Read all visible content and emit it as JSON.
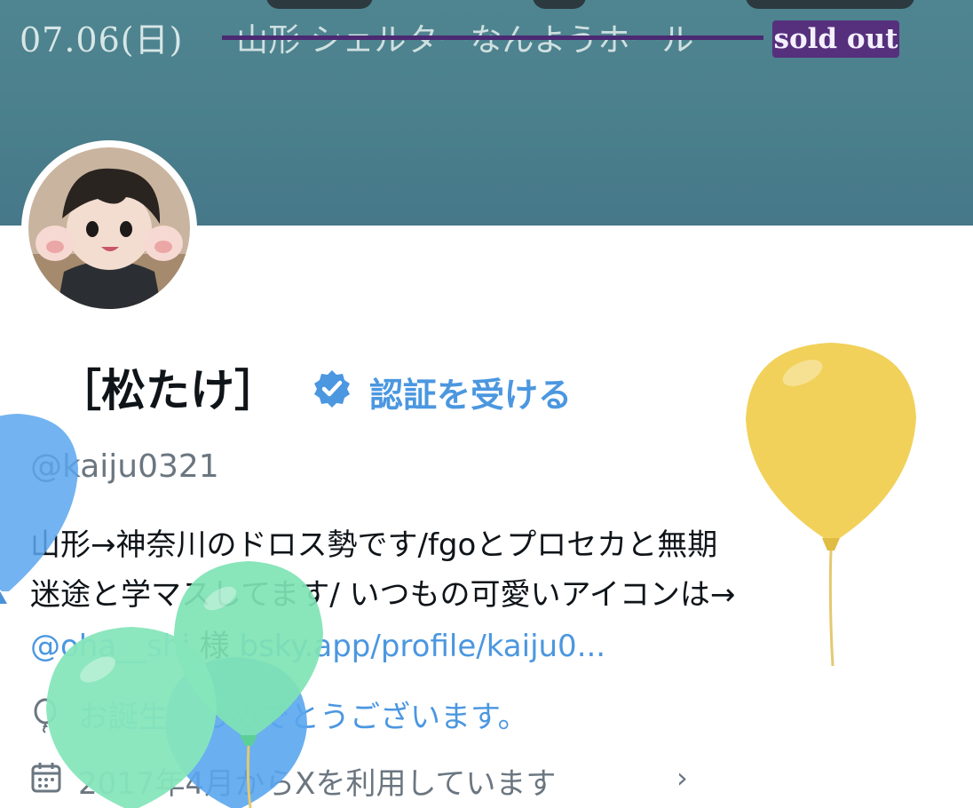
{
  "banner": {
    "date_text": "07.06(日)",
    "venue_text": "山形 シェルターなんようホール",
    "badge": "sold out",
    "strike_color": "#4b2a73",
    "badge_color": "#56307d"
  },
  "profile": {
    "display_name": "［松たけ］",
    "verify_label": "認証を受ける",
    "verified_icon": "verified-badge-icon",
    "handle": "@kaiju0321"
  },
  "bio": {
    "line1": "山形→神奈川のドロス勢です/fgoとプロセカと無期",
    "line2": "迷途と学マスしてます/ いつもの可愛いアイコンは→",
    "mention": "@oha__shi",
    "honorific": "様",
    "url": "bsky.app/profile/kaiju0..."
  },
  "meta": {
    "birthday_icon": "balloon-icon",
    "birthday_text": "お誕生日おめでとうございます。",
    "joined_icon": "calendar-icon",
    "joined_text": "2017年4月からXを利用しています",
    "chevron": "›"
  },
  "colors": {
    "accent": "#4b97e0",
    "muted_text": "#6b7680",
    "banner": "#4a7f8b",
    "balloon_yellow": "#f1d15a",
    "balloon_green": "#7fe3b4",
    "balloon_blue": "#5aa6ee"
  }
}
